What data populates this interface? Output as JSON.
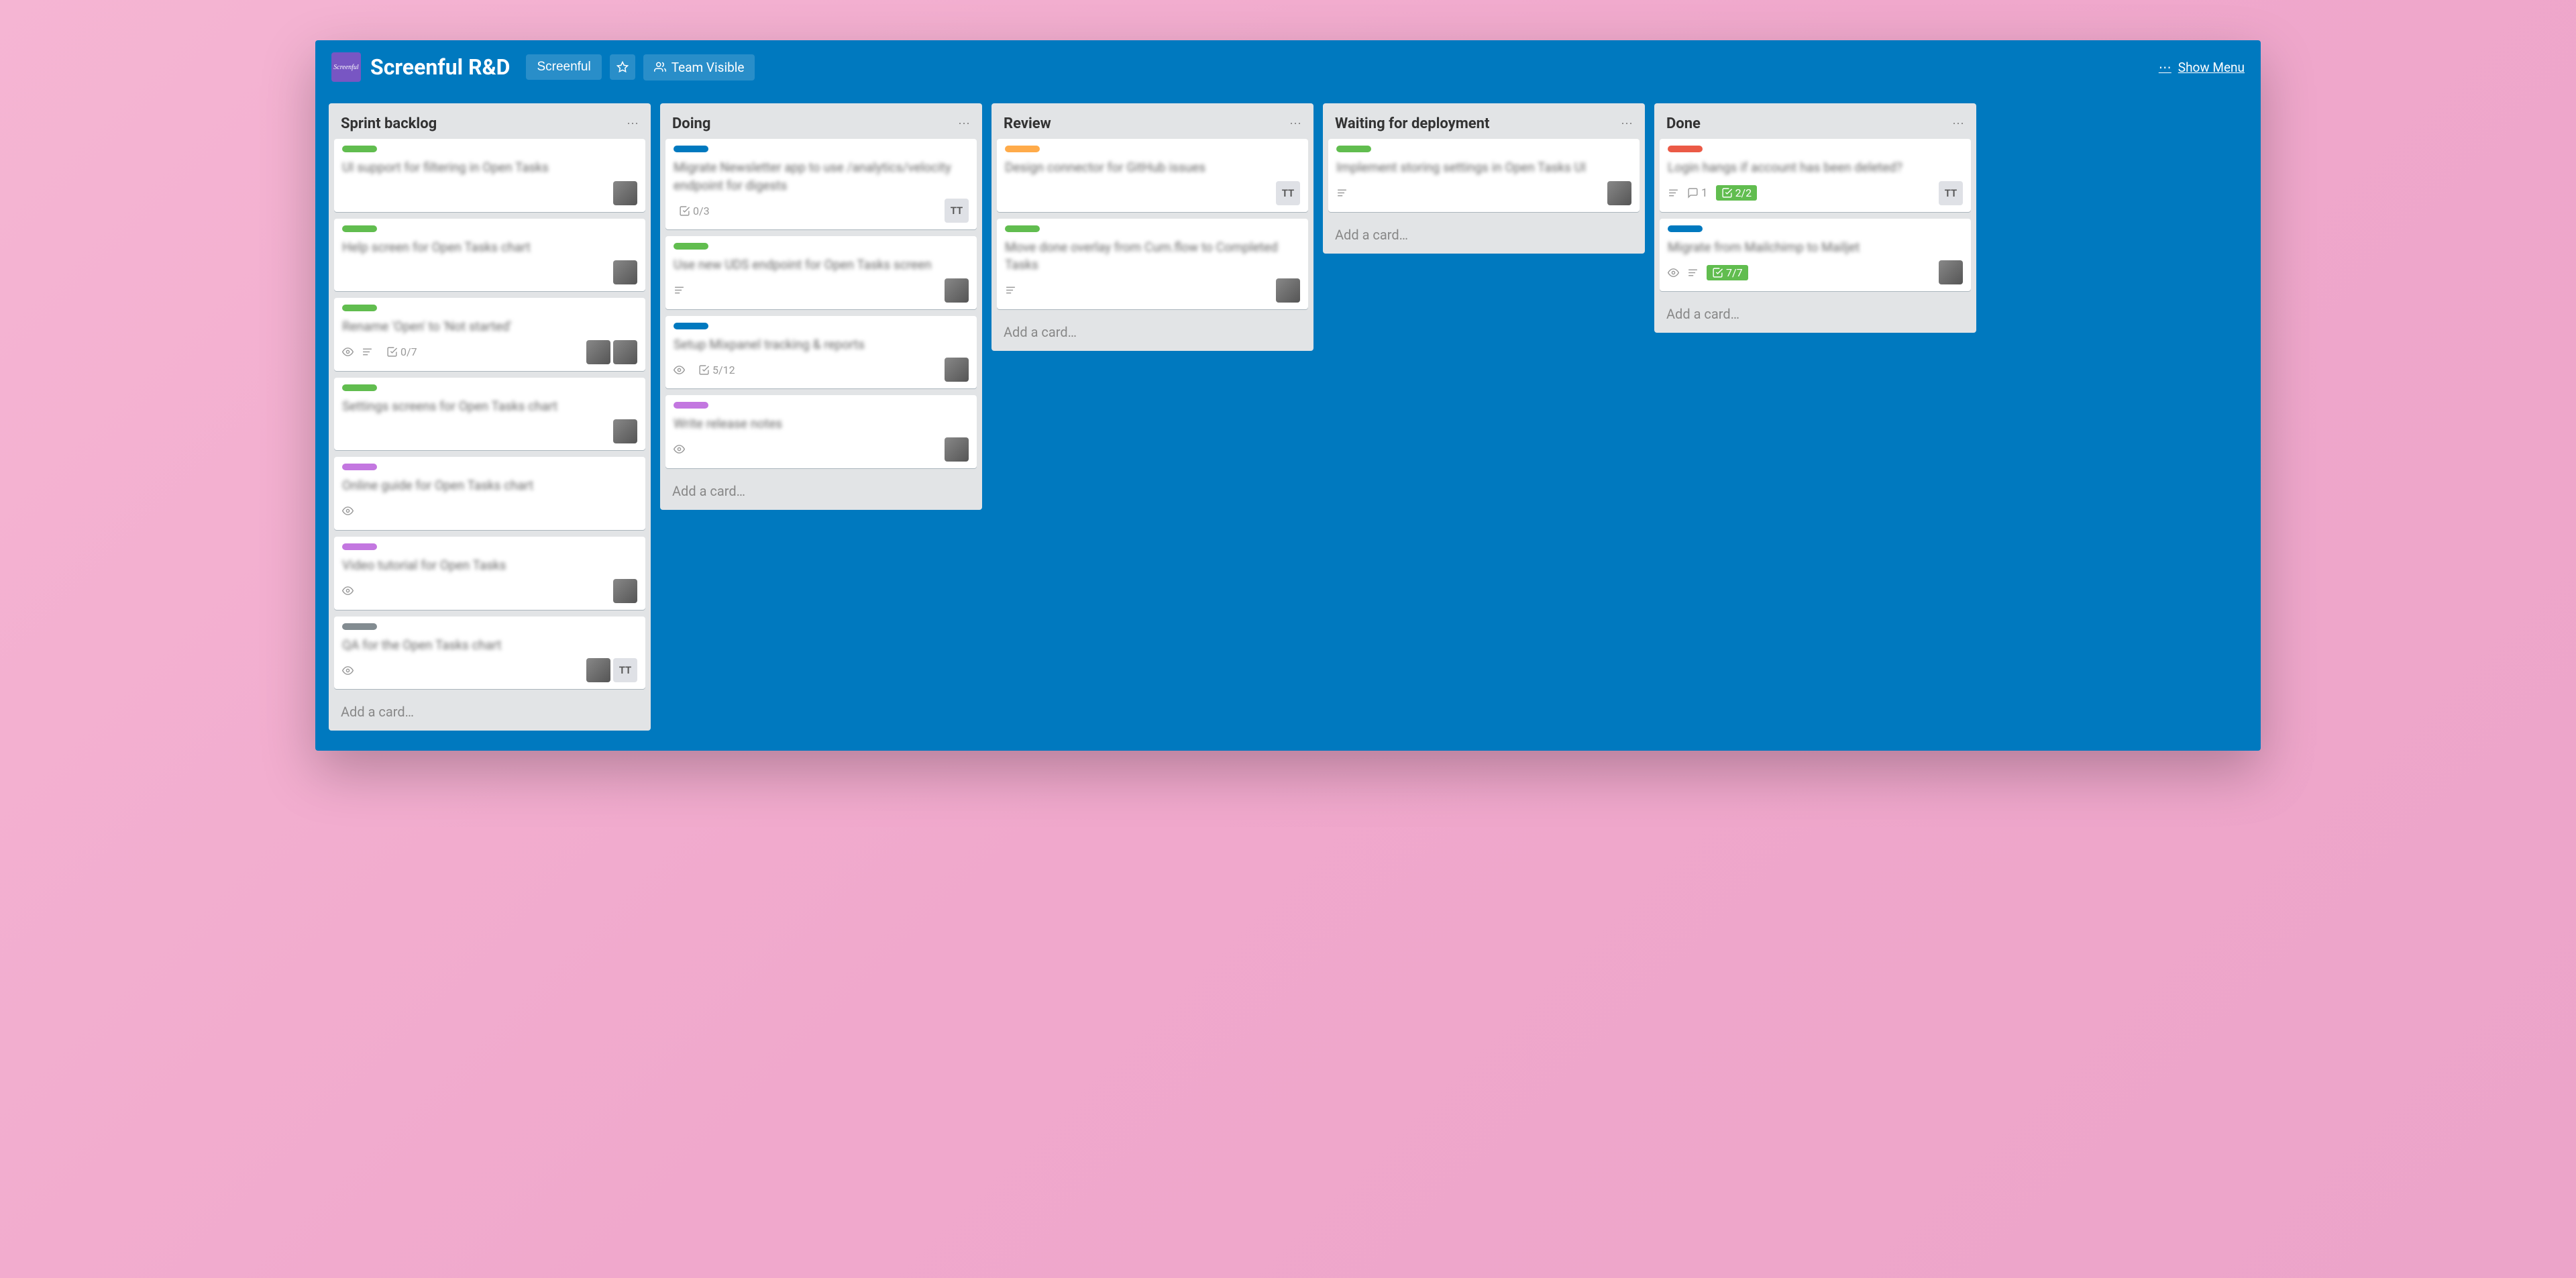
{
  "header": {
    "logo_text": "Screenful",
    "board_title": "Screenful R&D",
    "team_btn": "Screenful",
    "visibility": "Team Visible",
    "show_menu": "Show Menu"
  },
  "colors": {
    "green": "#61bd4f",
    "blue": "#0079bf",
    "purple": "#c377e0",
    "orange": "#ffab4a",
    "gray": "#838c91",
    "red": "#eb5a46"
  },
  "add_card_label": "Add a card…",
  "lists": [
    {
      "title": "Sprint backlog",
      "cards": [
        {
          "labels": [
            "green"
          ],
          "title": "UI support for filtering in Open Tasks",
          "badges": [],
          "members": [
            {
              "type": "avatar"
            }
          ]
        },
        {
          "labels": [
            "green"
          ],
          "title": "Help screen for Open Tasks chart",
          "badges": [],
          "members": [
            {
              "type": "avatar"
            }
          ]
        },
        {
          "labels": [
            "green"
          ],
          "title": "Rename 'Open' to 'Not started'",
          "badges": [
            {
              "type": "watch"
            },
            {
              "type": "desc"
            },
            {
              "type": "checklist",
              "text": "0/7"
            }
          ],
          "members": [
            {
              "type": "avatar"
            },
            {
              "type": "avatar"
            }
          ]
        },
        {
          "labels": [
            "green"
          ],
          "title": "Settings screens for Open Tasks chart",
          "badges": [],
          "members": [
            {
              "type": "avatar"
            }
          ]
        },
        {
          "labels": [
            "purple"
          ],
          "title": "Online guide for Open Tasks chart",
          "badges": [
            {
              "type": "watch"
            }
          ],
          "members": []
        },
        {
          "labels": [
            "purple"
          ],
          "title": "Video tutorial for Open Tasks",
          "badges": [
            {
              "type": "watch"
            }
          ],
          "members": [
            {
              "type": "avatar"
            }
          ]
        },
        {
          "labels": [
            "gray"
          ],
          "title": "QA for the Open Tasks chart",
          "badges": [
            {
              "type": "watch"
            }
          ],
          "members": [
            {
              "type": "avatar"
            },
            {
              "type": "initials",
              "text": "TT"
            }
          ]
        }
      ]
    },
    {
      "title": "Doing",
      "cards": [
        {
          "labels": [
            "blue"
          ],
          "title": "Migrate Newsletter app to use /analytics/velocity endpoint for digests",
          "badges": [
            {
              "type": "checklist",
              "text": "0/3"
            }
          ],
          "members": [
            {
              "type": "initials",
              "text": "TT"
            }
          ]
        },
        {
          "labels": [
            "green"
          ],
          "title": "Use new UDS endpoint for Open Tasks screen",
          "badges": [
            {
              "type": "desc"
            }
          ],
          "members": [
            {
              "type": "avatar"
            }
          ]
        },
        {
          "labels": [
            "blue"
          ],
          "title": "Setup Mixpanel tracking & reports",
          "badges": [
            {
              "type": "watch"
            },
            {
              "type": "checklist",
              "text": "5/12"
            }
          ],
          "members": [
            {
              "type": "avatar"
            }
          ]
        },
        {
          "labels": [
            "purple"
          ],
          "title": "Write release notes",
          "badges": [
            {
              "type": "watch"
            }
          ],
          "members": [
            {
              "type": "avatar"
            }
          ]
        }
      ]
    },
    {
      "title": "Review",
      "cards": [
        {
          "labels": [
            "orange"
          ],
          "title": "Design connector for GitHub issues",
          "badges": [],
          "members": [
            {
              "type": "initials",
              "text": "TT"
            }
          ]
        },
        {
          "labels": [
            "green"
          ],
          "title": "Move done overlay from Cum.flow to Completed Tasks",
          "badges": [
            {
              "type": "desc"
            }
          ],
          "members": [
            {
              "type": "avatar"
            }
          ]
        }
      ]
    },
    {
      "title": "Waiting for deployment",
      "cards": [
        {
          "labels": [
            "green"
          ],
          "title": "Implement storing settings in Open Tasks UI",
          "badges": [
            {
              "type": "desc"
            }
          ],
          "members": [
            {
              "type": "avatar"
            }
          ]
        }
      ]
    },
    {
      "title": "Done",
      "cards": [
        {
          "labels": [
            "red"
          ],
          "title": "Login hangs if account has been deleted?",
          "badges": [
            {
              "type": "desc"
            },
            {
              "type": "comments",
              "text": "1"
            },
            {
              "type": "checklist",
              "text": "2/2",
              "complete": true
            }
          ],
          "members": [
            {
              "type": "initials",
              "text": "TT"
            }
          ]
        },
        {
          "labels": [
            "blue"
          ],
          "title": "Migrate from Mailchimp to Mailjet",
          "badges": [
            {
              "type": "watch"
            },
            {
              "type": "desc"
            },
            {
              "type": "checklist",
              "text": "7/7",
              "complete": true
            }
          ],
          "members": [
            {
              "type": "avatar"
            }
          ]
        }
      ]
    }
  ]
}
